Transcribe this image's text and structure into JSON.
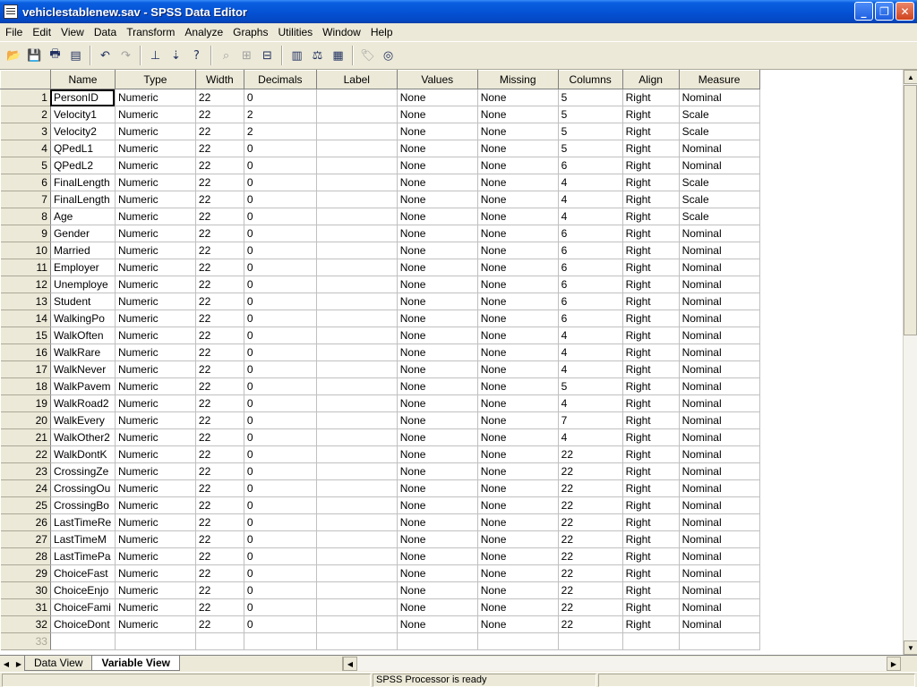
{
  "window": {
    "title": "vehiclestablenew.sav - SPSS Data Editor"
  },
  "icons": {
    "minimize": "minimize-icon",
    "maximize": "restore-icon",
    "close": "close-icon",
    "min_glyph": "_",
    "max_glyph": "❐",
    "close_glyph": "✕"
  },
  "menu": [
    "File",
    "Edit",
    "View",
    "Data",
    "Transform",
    "Analyze",
    "Graphs",
    "Utilities",
    "Window",
    "Help"
  ],
  "toolbar": [
    {
      "name": "open-file-icon",
      "glyph": "📂"
    },
    {
      "name": "save-icon",
      "glyph": "💾"
    },
    {
      "name": "print-icon",
      "glyph": "🖶"
    },
    {
      "name": "dialog-recall-icon",
      "glyph": "▤"
    },
    {
      "sep": true
    },
    {
      "name": "undo-icon",
      "glyph": "↶"
    },
    {
      "name": "redo-icon",
      "glyph": "↷",
      "disabled": true
    },
    {
      "sep": true
    },
    {
      "name": "goto-chart-icon",
      "glyph": "⊥"
    },
    {
      "name": "goto-case-icon",
      "glyph": "⇣"
    },
    {
      "name": "variables-icon",
      "glyph": "?"
    },
    {
      "sep": true
    },
    {
      "name": "find-icon",
      "glyph": "⌕",
      "disabled": true
    },
    {
      "name": "insert-cases-icon",
      "glyph": "⊞",
      "disabled": true
    },
    {
      "name": "insert-variable-icon",
      "glyph": "⊟"
    },
    {
      "sep": true
    },
    {
      "name": "split-file-icon",
      "glyph": "▥"
    },
    {
      "name": "weight-cases-icon",
      "glyph": "⚖"
    },
    {
      "name": "select-cases-icon",
      "glyph": "▦"
    },
    {
      "sep": true
    },
    {
      "name": "value-labels-icon",
      "glyph": "🏷",
      "disabled": true
    },
    {
      "name": "use-sets-icon",
      "glyph": "◎"
    }
  ],
  "grid": {
    "columns": [
      "Name",
      "Type",
      "Width",
      "Decimals",
      "Label",
      "Values",
      "Missing",
      "Columns",
      "Align",
      "Measure"
    ],
    "rows": [
      [
        "PersonID",
        "Numeric",
        "22",
        "0",
        "",
        "None",
        "None",
        "5",
        "Right",
        "Nominal"
      ],
      [
        "Velocity1",
        "Numeric",
        "22",
        "2",
        "",
        "None",
        "None",
        "5",
        "Right",
        "Scale"
      ],
      [
        "Velocity2",
        "Numeric",
        "22",
        "2",
        "",
        "None",
        "None",
        "5",
        "Right",
        "Scale"
      ],
      [
        "QPedL1",
        "Numeric",
        "22",
        "0",
        "",
        "None",
        "None",
        "5",
        "Right",
        "Nominal"
      ],
      [
        "QPedL2",
        "Numeric",
        "22",
        "0",
        "",
        "None",
        "None",
        "6",
        "Right",
        "Nominal"
      ],
      [
        "FinalLength",
        "Numeric",
        "22",
        "0",
        "",
        "None",
        "None",
        "4",
        "Right",
        "Scale"
      ],
      [
        "FinalLength",
        "Numeric",
        "22",
        "0",
        "",
        "None",
        "None",
        "4",
        "Right",
        "Scale"
      ],
      [
        "Age",
        "Numeric",
        "22",
        "0",
        "",
        "None",
        "None",
        "4",
        "Right",
        "Scale"
      ],
      [
        "Gender",
        "Numeric",
        "22",
        "0",
        "",
        "None",
        "None",
        "6",
        "Right",
        "Nominal"
      ],
      [
        "Married",
        "Numeric",
        "22",
        "0",
        "",
        "None",
        "None",
        "6",
        "Right",
        "Nominal"
      ],
      [
        "Employer",
        "Numeric",
        "22",
        "0",
        "",
        "None",
        "None",
        "6",
        "Right",
        "Nominal"
      ],
      [
        "Unemploye",
        "Numeric",
        "22",
        "0",
        "",
        "None",
        "None",
        "6",
        "Right",
        "Nominal"
      ],
      [
        "Student",
        "Numeric",
        "22",
        "0",
        "",
        "None",
        "None",
        "6",
        "Right",
        "Nominal"
      ],
      [
        "WalkingPo",
        "Numeric",
        "22",
        "0",
        "",
        "None",
        "None",
        "6",
        "Right",
        "Nominal"
      ],
      [
        "WalkOften",
        "Numeric",
        "22",
        "0",
        "",
        "None",
        "None",
        "4",
        "Right",
        "Nominal"
      ],
      [
        "WalkRare",
        "Numeric",
        "22",
        "0",
        "",
        "None",
        "None",
        "4",
        "Right",
        "Nominal"
      ],
      [
        "WalkNever",
        "Numeric",
        "22",
        "0",
        "",
        "None",
        "None",
        "4",
        "Right",
        "Nominal"
      ],
      [
        "WalkPavem",
        "Numeric",
        "22",
        "0",
        "",
        "None",
        "None",
        "5",
        "Right",
        "Nominal"
      ],
      [
        "WalkRoad2",
        "Numeric",
        "22",
        "0",
        "",
        "None",
        "None",
        "4",
        "Right",
        "Nominal"
      ],
      [
        "WalkEvery",
        "Numeric",
        "22",
        "0",
        "",
        "None",
        "None",
        "7",
        "Right",
        "Nominal"
      ],
      [
        "WalkOther2",
        "Numeric",
        "22",
        "0",
        "",
        "None",
        "None",
        "4",
        "Right",
        "Nominal"
      ],
      [
        "WalkDontK",
        "Numeric",
        "22",
        "0",
        "",
        "None",
        "None",
        "22",
        "Right",
        "Nominal"
      ],
      [
        "CrossingZe",
        "Numeric",
        "22",
        "0",
        "",
        "None",
        "None",
        "22",
        "Right",
        "Nominal"
      ],
      [
        "CrossingOu",
        "Numeric",
        "22",
        "0",
        "",
        "None",
        "None",
        "22",
        "Right",
        "Nominal"
      ],
      [
        "CrossingBo",
        "Numeric",
        "22",
        "0",
        "",
        "None",
        "None",
        "22",
        "Right",
        "Nominal"
      ],
      [
        "LastTimeRe",
        "Numeric",
        "22",
        "0",
        "",
        "None",
        "None",
        "22",
        "Right",
        "Nominal"
      ],
      [
        "LastTimeM",
        "Numeric",
        "22",
        "0",
        "",
        "None",
        "None",
        "22",
        "Right",
        "Nominal"
      ],
      [
        "LastTimePa",
        "Numeric",
        "22",
        "0",
        "",
        "None",
        "None",
        "22",
        "Right",
        "Nominal"
      ],
      [
        "ChoiceFast",
        "Numeric",
        "22",
        "0",
        "",
        "None",
        "None",
        "22",
        "Right",
        "Nominal"
      ],
      [
        "ChoiceEnjo",
        "Numeric",
        "22",
        "0",
        "",
        "None",
        "None",
        "22",
        "Right",
        "Nominal"
      ],
      [
        "ChoiceFami",
        "Numeric",
        "22",
        "0",
        "",
        "None",
        "None",
        "22",
        "Right",
        "Nominal"
      ],
      [
        "ChoiceDont",
        "Numeric",
        "22",
        "0",
        "",
        "None",
        "None",
        "22",
        "Right",
        "Nominal"
      ]
    ],
    "empty_row_numbers": [
      "33"
    ],
    "selected_cell": {
      "row": 0,
      "col": 0
    }
  },
  "tabs": [
    {
      "label": "Data View",
      "active": false
    },
    {
      "label": "Variable View",
      "active": true
    }
  ],
  "status": {
    "processor": "SPSS Processor  is ready"
  }
}
